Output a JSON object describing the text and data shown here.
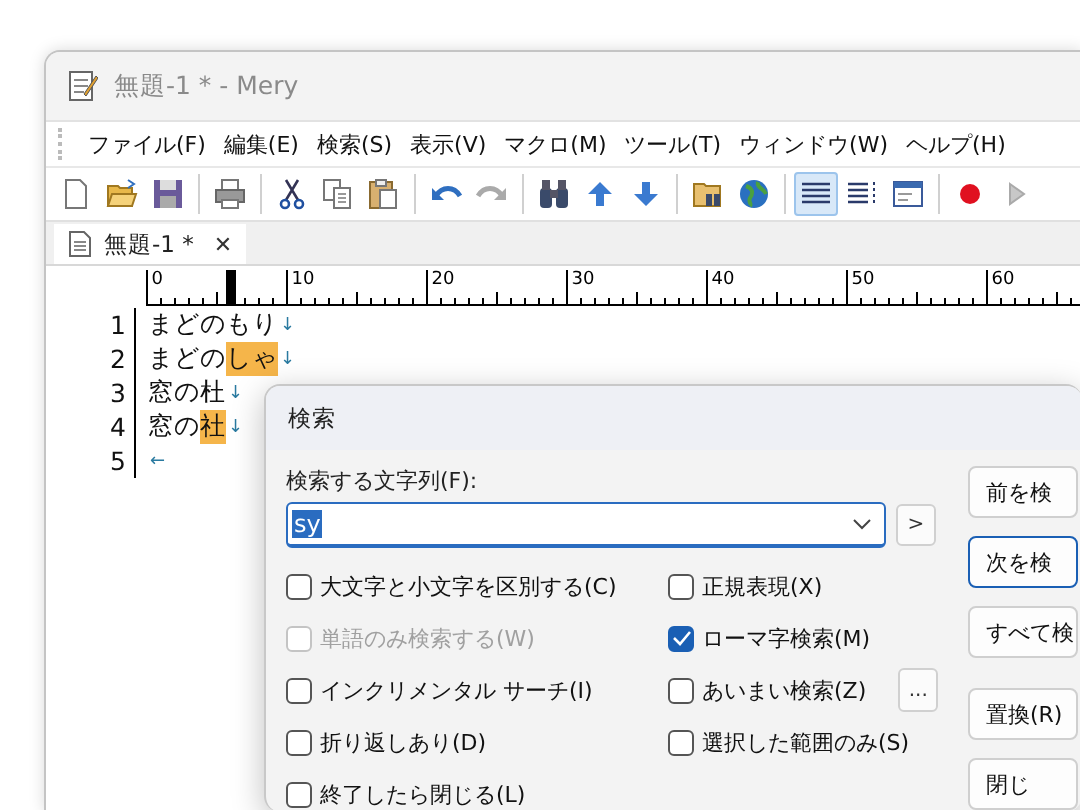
{
  "window": {
    "title": "無題-1 * - Mery"
  },
  "menu": [
    "ファイル(F)",
    "編集(E)",
    "検索(S)",
    "表示(V)",
    "マクロ(M)",
    "ツール(T)",
    "ウィンドウ(W)",
    "ヘルプ(H)"
  ],
  "toolbar": [
    {
      "kind": "new",
      "pressed": false
    },
    {
      "kind": "open",
      "pressed": false
    },
    {
      "kind": "save",
      "pressed": false
    },
    {
      "kind": "sep"
    },
    {
      "kind": "print",
      "pressed": false
    },
    {
      "kind": "sep"
    },
    {
      "kind": "cut",
      "pressed": false
    },
    {
      "kind": "copy",
      "pressed": false
    },
    {
      "kind": "paste",
      "pressed": false
    },
    {
      "kind": "sep"
    },
    {
      "kind": "undo",
      "pressed": false
    },
    {
      "kind": "redo",
      "pressed": false
    },
    {
      "kind": "sep"
    },
    {
      "kind": "find",
      "pressed": false
    },
    {
      "kind": "up",
      "pressed": false
    },
    {
      "kind": "down",
      "pressed": false
    },
    {
      "kind": "sep"
    },
    {
      "kind": "folder-find",
      "pressed": false
    },
    {
      "kind": "globe",
      "pressed": false
    },
    {
      "kind": "sep"
    },
    {
      "kind": "lines",
      "pressed": true
    },
    {
      "kind": "wrap",
      "pressed": false
    },
    {
      "kind": "window",
      "pressed": false
    },
    {
      "kind": "sep"
    },
    {
      "kind": "record",
      "pressed": false
    },
    {
      "kind": "play",
      "pressed": false
    }
  ],
  "tabs": [
    {
      "label": "無題-1 *",
      "close": "✕",
      "selected": true
    }
  ],
  "ruler": {
    "labels": [
      "0",
      "10",
      "20",
      "30",
      "40",
      "50",
      "60"
    ]
  },
  "lines": [
    {
      "number": "1",
      "segments": [
        {
          "text": "まどのもり",
          "highlight": false
        }
      ],
      "end": "↓"
    },
    {
      "number": "2",
      "segments": [
        {
          "text": "まどの",
          "highlight": false
        },
        {
          "text": "しゃ",
          "highlight": true
        }
      ],
      "end": "↓"
    },
    {
      "number": "3",
      "segments": [
        {
          "text": "窓の杜",
          "highlight": false
        }
      ],
      "end": "↓"
    },
    {
      "number": "4",
      "segments": [
        {
          "text": "窓の",
          "highlight": false
        },
        {
          "text": "社",
          "highlight": true
        }
      ],
      "end": "↓"
    },
    {
      "number": "5",
      "end": "←"
    }
  ],
  "dialog": {
    "title": "検索",
    "field_label": "検索する文字列(F):",
    "value": "sy",
    "more_button": ">",
    "options": [
      {
        "label": "大文字と小文字を区別する(C)",
        "checked": false,
        "disabled": false
      },
      {
        "label": "正規表現(X)",
        "checked": false,
        "disabled": false
      },
      {
        "label": "単語のみ検索する(W)",
        "checked": false,
        "disabled": true
      },
      {
        "label": "ローマ字検索(M)",
        "checked": true,
        "disabled": false
      },
      {
        "label": "インクリメンタル サーチ(I)",
        "checked": false,
        "disabled": false
      },
      {
        "label": "あいまい検索(Z)",
        "checked": false,
        "disabled": false,
        "extra": "..."
      },
      {
        "label": "折り返しあり(D)",
        "checked": false,
        "disabled": false
      },
      {
        "label": "選択した範囲のみ(S)",
        "checked": false,
        "disabled": false
      },
      {
        "label": "終了したら閉じる(L)",
        "checked": false,
        "disabled": false
      }
    ],
    "buttons": [
      {
        "label": "前を検",
        "default": false
      },
      {
        "label": "次を検",
        "default": true
      },
      {
        "label": "すべて検",
        "default": false
      },
      {
        "label": "置換(R)",
        "default": false
      },
      {
        "label": "閉じ",
        "default": false
      }
    ]
  }
}
